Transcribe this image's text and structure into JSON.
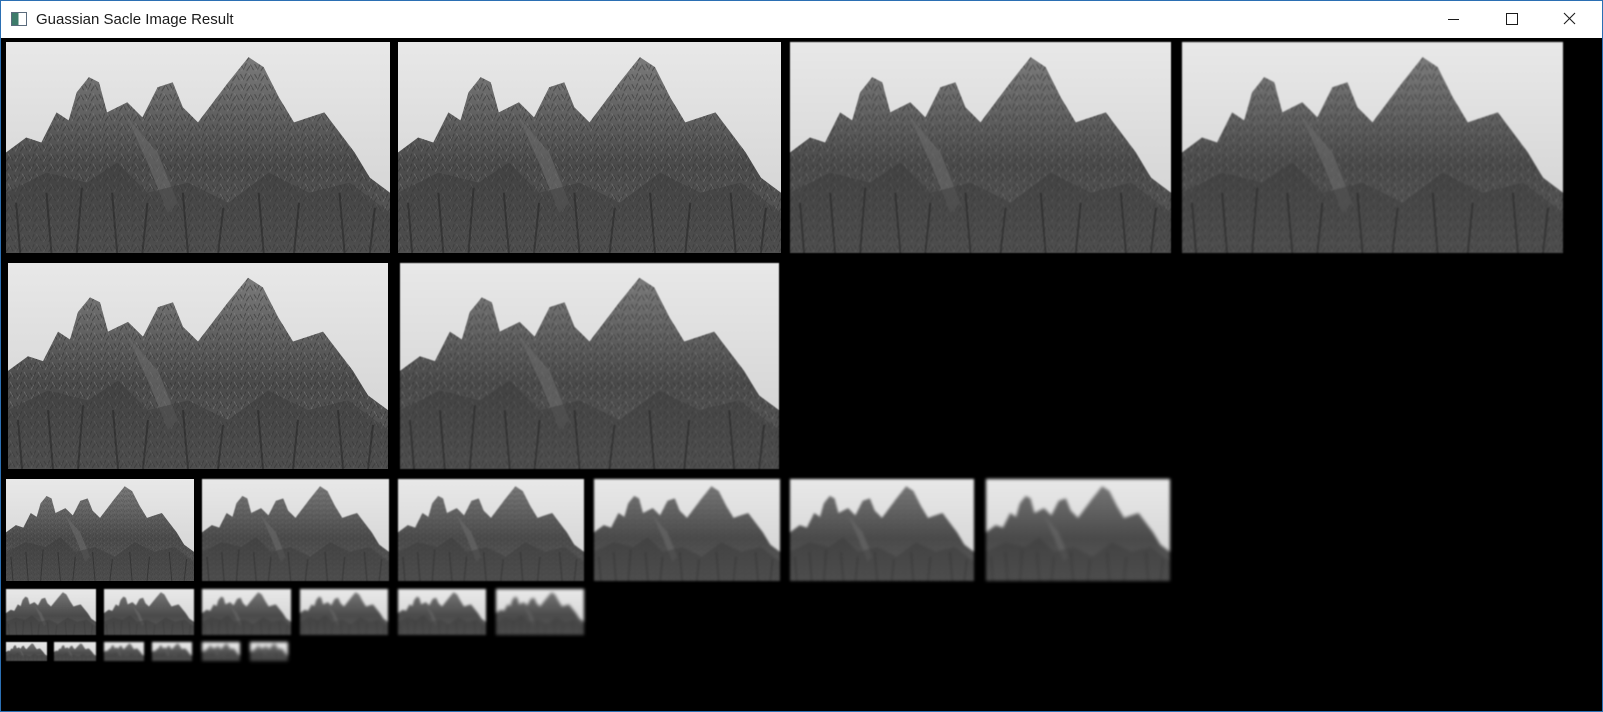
{
  "window": {
    "title": "Guassian Sacle Image Result"
  },
  "icons": {
    "app": "app-window-icon",
    "minimize": "minimize-icon",
    "maximize": "maximize-icon",
    "close": "close-icon"
  },
  "pyramid": {
    "octaves": 5,
    "scales_per_octave": 6
  }
}
